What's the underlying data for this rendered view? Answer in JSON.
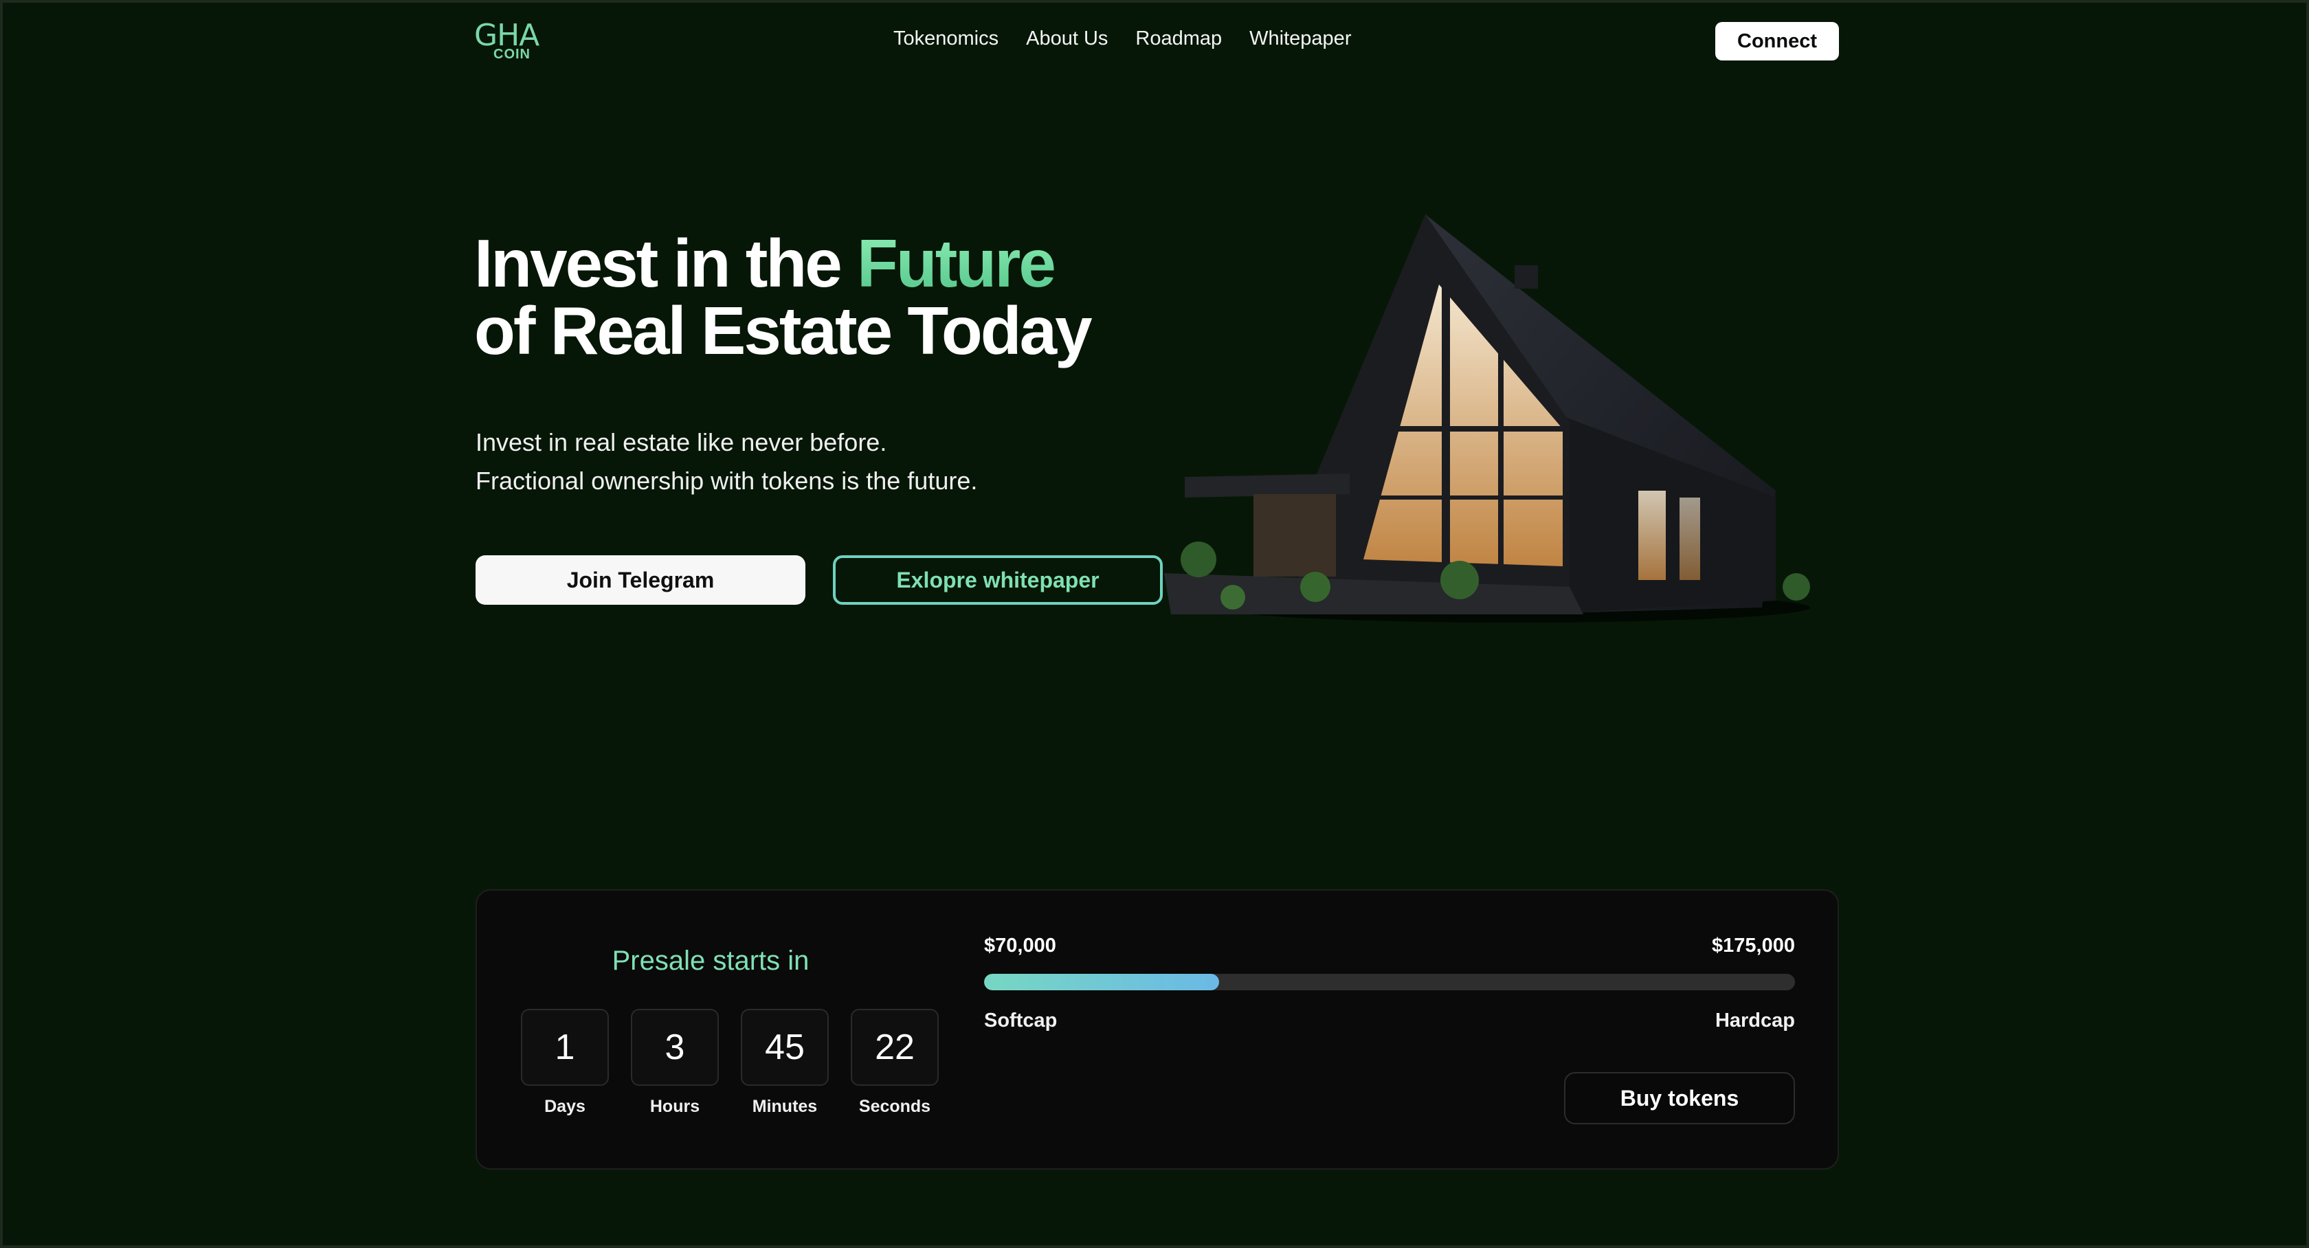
{
  "header": {
    "logo_main": "GHA",
    "logo_sub": "COIN",
    "nav": [
      "Tokenomics",
      "About Us",
      "Roadmap",
      "Whitepaper"
    ],
    "connect_label": "Connect"
  },
  "hero": {
    "title_part1": "Invest in the ",
    "title_accent": "Future",
    "title_line2": "of Real Estate Today",
    "subtitle_line1": "Invest in real estate like never before.",
    "subtitle_line2": "Fractional ownership with tokens is the future.",
    "telegram_label": "Join Telegram",
    "whitepaper_label": "Exlopre whitepaper"
  },
  "presale": {
    "label": "Presale starts in",
    "countdown": [
      {
        "value": "1",
        "unit": "Days"
      },
      {
        "value": "3",
        "unit": "Hours"
      },
      {
        "value": "45",
        "unit": "Minutes"
      },
      {
        "value": "22",
        "unit": "Seconds"
      }
    ],
    "softcap_value": "$70,000",
    "hardcap_value": "$175,000",
    "softcap_label": "Softcap",
    "hardcap_label": "Hardcap",
    "progress_fraction": 0.29,
    "buy_label": "Buy tokens"
  },
  "colors": {
    "background": "#071707",
    "accent": "#7fe0b4",
    "progress_start": "#77d7c2",
    "progress_end": "#6ab9e6"
  }
}
